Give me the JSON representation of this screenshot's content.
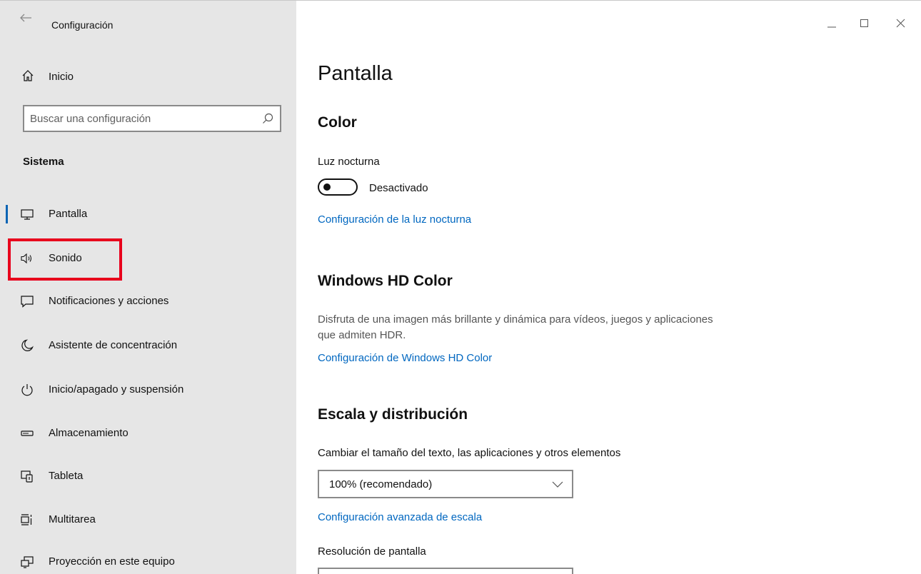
{
  "window": {
    "title": "Configuración"
  },
  "sidebar": {
    "home_label": "Inicio",
    "search_placeholder": "Buscar una configuración",
    "section_title": "Sistema",
    "items": [
      {
        "label": "Pantalla",
        "icon": "monitor-icon",
        "active": true
      },
      {
        "label": "Sonido",
        "icon": "speaker-icon"
      },
      {
        "label": "Notificaciones y acciones",
        "icon": "notification-icon"
      },
      {
        "label": "Asistente de concentración",
        "icon": "moon-icon"
      },
      {
        "label": "Inicio/apagado y suspensión",
        "icon": "power-icon"
      },
      {
        "label": "Almacenamiento",
        "icon": "storage-icon"
      },
      {
        "label": "Tableta",
        "icon": "tablet-icon"
      },
      {
        "label": "Multitarea",
        "icon": "multitask-icon"
      },
      {
        "label": "Proyección en este equipo",
        "icon": "projection-icon"
      }
    ]
  },
  "content": {
    "title": "Pantalla",
    "color": {
      "heading": "Color",
      "night_light_label": "Luz nocturna",
      "night_light_state": "Desactivado",
      "night_light_settings_link": "Configuración de la luz nocturna"
    },
    "hdr": {
      "heading": "Windows HD Color",
      "description": "Disfruta de una imagen más brillante y dinámica para vídeos, juegos y aplicaciones que admiten HDR.",
      "settings_link": "Configuración de Windows HD Color"
    },
    "scale": {
      "heading": "Escala y distribución",
      "size_label": "Cambiar el tamaño del texto, las aplicaciones y otros elementos",
      "size_value": "100% (recomendado)",
      "advanced_link": "Configuración avanzada de escala",
      "resolution_label": "Resolución de pantalla"
    }
  },
  "colors": {
    "accent": "#0067c0",
    "highlight": "#e8001c",
    "sidebar_bg": "#e6e6e6"
  }
}
